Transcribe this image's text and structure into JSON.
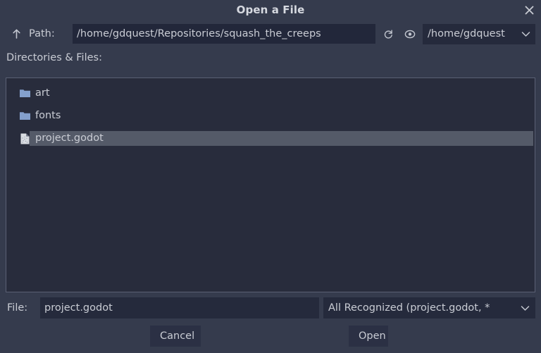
{
  "dialog": {
    "title": "Open a File",
    "close_icon": "close-icon"
  },
  "path_bar": {
    "up_icon": "arrow-up-icon",
    "label": "Path:",
    "value": "/home/gdquest/Repositories/squash_the_creeps",
    "placeholder": "Path",
    "reload_icon": "reload-icon",
    "show_hidden_icon": "eye-icon",
    "drive": {
      "value": "/home/gdquest",
      "chevron_icon": "chevron-down-icon"
    }
  },
  "list": {
    "label": "Directories & Files:",
    "entries": [
      {
        "name": "art",
        "type": "folder",
        "icon": "folder-icon",
        "selected": false
      },
      {
        "name": "fonts",
        "type": "folder",
        "icon": "folder-icon",
        "selected": false
      },
      {
        "name": "project.godot",
        "type": "file",
        "icon": "file-icon",
        "selected": true
      }
    ]
  },
  "file_bar": {
    "label": "File:",
    "value": "project.godot",
    "placeholder": "File name",
    "filter": {
      "value": "All Recognized (project.godot, *",
      "chevron_icon": "chevron-down-icon"
    }
  },
  "actions": {
    "cancel_label": "Cancel",
    "open_label": "Open"
  },
  "colors": {
    "dialog_bg": "#353b4d",
    "list_bg": "#282c3c",
    "input_bg": "#22273a",
    "selection": "#545a68",
    "folder_icon": "#84a0cd",
    "text": "#c9ccd4",
    "border": "#5a6074"
  }
}
